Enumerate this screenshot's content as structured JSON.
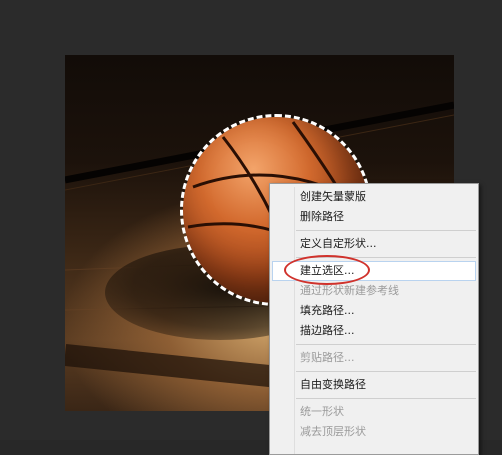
{
  "context_menu": {
    "items": [
      {
        "label": "创建矢量蒙版",
        "enabled": true
      },
      {
        "label": "删除路径",
        "enabled": true
      },
      {
        "separator": true
      },
      {
        "label": "定义自定形状...",
        "enabled": true
      },
      {
        "separator": true
      },
      {
        "label": "建立选区...",
        "enabled": true,
        "highlighted": true
      },
      {
        "label": "通过形状新建参考线",
        "enabled": false
      },
      {
        "label": "填充路径...",
        "enabled": true
      },
      {
        "label": "描边路径...",
        "enabled": true
      },
      {
        "separator": true
      },
      {
        "label": "剪贴路径...",
        "enabled": false
      },
      {
        "separator": true
      },
      {
        "label": "自由变换路径",
        "enabled": true
      },
      {
        "separator": true
      },
      {
        "label": "统一形状",
        "enabled": false
      },
      {
        "label": "减去顶层形状",
        "enabled": false
      }
    ]
  },
  "colors": {
    "highlight_ring": "#d0322c",
    "menu_background": "#f0f0f0",
    "workspace_background": "#2b2b2b"
  }
}
